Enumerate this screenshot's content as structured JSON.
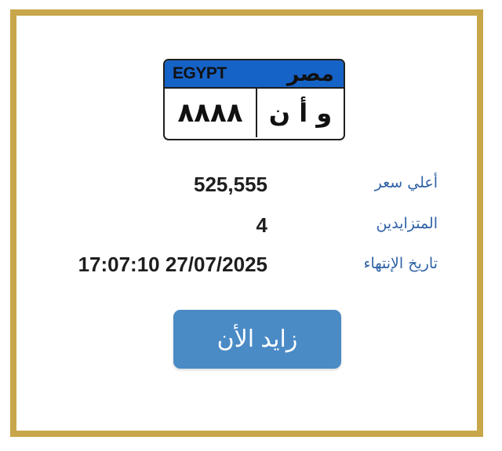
{
  "plate": {
    "country_en": "EGYPT",
    "country_ar": "مصر",
    "number": "٨٨٨٨",
    "letters": "و أ ن"
  },
  "details": {
    "highest_price_label": "أعلي سعر",
    "highest_price_value": "525,555",
    "bidders_label": "المتزايدين",
    "bidders_value": "4",
    "end_date_label": "تاريخ الإنتهاء",
    "end_date_value": "17:07:10 27/07/2025"
  },
  "actions": {
    "bid_button_label": "زايد الأن"
  },
  "colors": {
    "frame": "#c8a64a",
    "plate_header": "#1663c7",
    "label_text": "#2f62a6",
    "button": "#4a8bc6"
  }
}
